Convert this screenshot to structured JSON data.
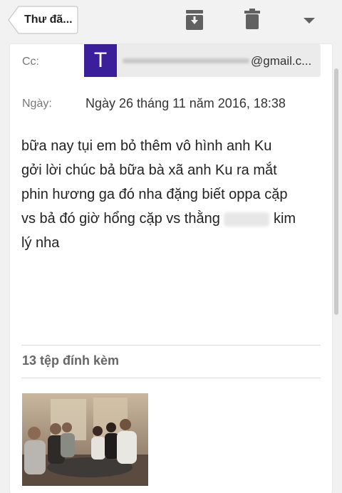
{
  "toolbar": {
    "back_label": "Thư đã...",
    "archive_icon": "archive-down-icon",
    "delete_icon": "trash-icon",
    "more_icon": "dropdown-triangle-icon"
  },
  "message": {
    "cc": {
      "label": "Cc:",
      "avatar_letter": "T",
      "email_domain": "@gmail.c..."
    },
    "date": {
      "label": "Ngày:",
      "value": "Ngày 26 tháng 11 năm 2016, 18:38"
    },
    "body_lines": [
      "bữa nay tụi em bỏ thêm vô hình anh Ku",
      "gởi lời chúc bả bữa bà xã anh Ku ra mắt",
      "phin hương ga đó nha đặng biết oppa cặp",
      "vs bả đó giờ hổng cặp vs thằng",
      "kim",
      "lý nha"
    ]
  },
  "attachments": {
    "title": "13 tệp đính kèm"
  },
  "colors": {
    "avatar_bg": "#3a1e9a",
    "icon_gray": "#616161"
  }
}
